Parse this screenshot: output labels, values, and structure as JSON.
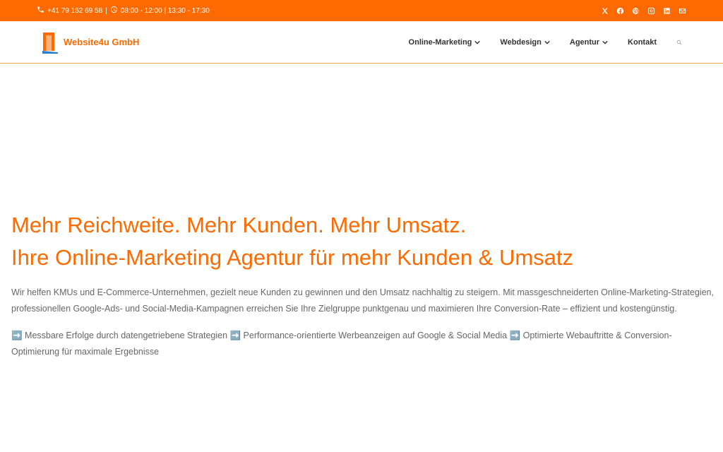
{
  "topbar": {
    "phone": "+41 79 152 69 58",
    "hours": "08:00 - 12:00 | 13:30 - 17:30",
    "social": [
      "x-icon",
      "facebook-icon",
      "pinterest-icon",
      "instagram-icon",
      "linkedin-icon",
      "mail-icon"
    ]
  },
  "header": {
    "brand": "Website4u GmbH",
    "nav": [
      {
        "label": "Online-Marketing"
      },
      {
        "label": "Webdesign"
      },
      {
        "label": "Agentur"
      },
      {
        "label": "Kontakt"
      }
    ]
  },
  "hero": {
    "headline_1": "Mehr Reichweite. Mehr Kunden. Mehr Umsatz.",
    "headline_2": "Ihre Online-Marketing Agentur für mehr Kunden & Umsatz",
    "intro": "Wir helfen KMUs und E-Commerce-Unternehmen, gezielt neue Kunden zu gewinnen und den Umsatz nachhaltig zu steigern. Mit massgeschneiderten Online-Marketing-Strategien, professionellen Google-Ads- und Social-Media-Kampagnen erreichen Sie Ihre Zielgruppe punktgenau und maximieren Ihre Conversion-Rate – effizient und kostengünstig.",
    "benefits": "➡️ Messbare Erfolge durch datengetriebene Strategien ➡️ Performance-orientierte Werbeanzeigen auf Google & Social Media ➡️ Optimierte Webauftritte & Conversion-Optimierung für maximale Ergebnisse"
  },
  "colors": {
    "accent": "#ff6a00"
  }
}
